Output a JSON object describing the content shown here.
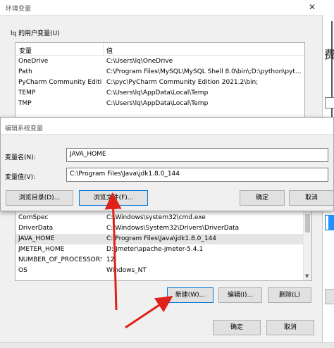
{
  "outer_window": {
    "title": "环境变量",
    "close_glyph": "✕",
    "user_vars_label": "lq 的用户变量(U)",
    "user_vars": {
      "headers": [
        "变量",
        "值"
      ],
      "rows": [
        [
          "OneDrive",
          "C:\\Users\\lq\\OneDrive"
        ],
        [
          "Path",
          "C:\\Program Files\\MySQL\\MySQL Shell 8.0\\bin\\;D:\\python\\pyt..."
        ],
        [
          "PyCharm Community Edition",
          "C:\\pyc\\PyCharm Community Edition 2021.2\\bin;"
        ],
        [
          "TEMP",
          "C:\\Users\\lq\\AppData\\Local\\Temp"
        ],
        [
          "TMP",
          "C:\\Users\\lq\\AppData\\Local\\Temp"
        ]
      ]
    },
    "system_vars": {
      "rows": [
        [
          "ComSpec",
          "C:\\Windows\\system32\\cmd.exe"
        ],
        [
          "DriverData",
          "C:\\Windows\\System32\\Drivers\\DriverData"
        ],
        [
          "JAVA_HOME",
          "C:\\Program Files\\Java\\jdk1.8.0_144"
        ],
        [
          "JMETER_HOME",
          "D:\\Jmeter\\apache-jmeter-5.4.1"
        ],
        [
          "NUMBER_OF_PROCESSORS",
          "12"
        ],
        [
          "OS",
          "Windows_NT"
        ]
      ],
      "selected_index": 2
    },
    "new_button": "新建(W)...",
    "edit_button": "编辑(I)...",
    "delete_button": "删除(L)",
    "ok_button": "确定",
    "cancel_button": "取消"
  },
  "edit_dialog": {
    "title": "编辑系统变量",
    "name_label": "变量名(N):",
    "name_value": "JAVA_HOME",
    "value_label": "变量值(V):",
    "value_value": "C:\\Program Files\\Java\\jdk1.8.0_144",
    "browse_dir_button": "浏览目录(D)...",
    "browse_file_button": "浏览文件(F)...",
    "ok_button": "确定",
    "cancel_button": "取消"
  },
  "background_fragment": {
    "char": "费"
  },
  "colors": {
    "accent": "#0078d7",
    "annotation_arrow": "#e0201a",
    "dialog_bg": "#f0f0f0"
  }
}
